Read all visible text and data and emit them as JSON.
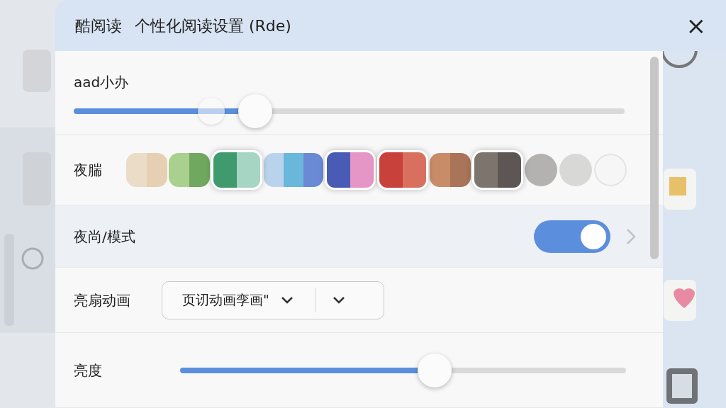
{
  "dialog": {
    "app_name": "酷阅读",
    "title": "个性化阅读设置 (Rde)",
    "close": "×"
  },
  "font_size": {
    "label": "aad小办",
    "level": 0.33
  },
  "theme": {
    "label": "夜腨",
    "swatches": [
      {
        "segments": [
          {
            "color": "#eadcc7"
          },
          {
            "color": "#e6cfb3"
          }
        ],
        "selected": false
      },
      {
        "segments": [
          {
            "color": "#a9d08e"
          },
          {
            "color": "#6fa85e"
          }
        ],
        "selected": false
      },
      {
        "segments": [
          {
            "color": "#3f9a6e"
          },
          {
            "color": "#a6d5c3"
          }
        ],
        "selected": true
      },
      {
        "segments": [
          {
            "color": "#b9d3ec"
          },
          {
            "color": "#6ab7dc"
          },
          {
            "color": "#6b8ad6"
          }
        ],
        "selected": false
      },
      {
        "segments": [
          {
            "color": "#4a5bb5"
          },
          {
            "color": "#e595c6"
          }
        ],
        "selected": true
      },
      {
        "segments": [
          {
            "color": "#c8413a"
          },
          {
            "color": "#d9705f"
          }
        ],
        "selected": true
      },
      {
        "segments": [
          {
            "color": "#c98c68"
          },
          {
            "color": "#a97458"
          }
        ],
        "selected": false
      },
      {
        "segments": [
          {
            "color": "#7e746e"
          },
          {
            "color": "#5d5654"
          }
        ],
        "selected": true
      },
      {
        "segments": [
          {
            "color": "#b3b2b0"
          }
        ],
        "selected": false
      },
      {
        "segments": [
          {
            "color": "#d8d8d6"
          }
        ],
        "selected": false
      },
      {
        "segments": [
          {
            "color": "#f6f6f6"
          }
        ],
        "selected": false
      }
    ]
  },
  "night_mode": {
    "label": "夜尚/模式",
    "on": true
  },
  "page_animation": {
    "label": "亮扇动画",
    "value": "页讱动画孪画\""
  },
  "brightness": {
    "label": "亮度",
    "level": 0.57
  }
}
